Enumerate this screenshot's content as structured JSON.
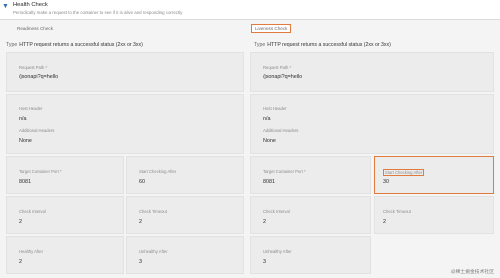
{
  "header": {
    "toggle_glyph": "▼",
    "title": "Health Check",
    "description": "Periodically make a request to the container to see if it is alive and responding correctly"
  },
  "readiness": {
    "label": "Readiness Check",
    "type_key": "Type",
    "type_value": "HTTP request returns a successful status (2xx or 3xx)",
    "request_path_label": "Request Path *",
    "request_path_value": "/jsonapi?q=hello",
    "host_header_label": "Host Header",
    "host_header_value": "n/a",
    "additional_headers_label": "Additional Headers",
    "additional_headers_value": "None",
    "target_port_label": "Target Container Port *",
    "target_port_value": "8081",
    "start_checking_label": "Start Checking After",
    "start_checking_value": "60",
    "check_interval_label": "Check Interval",
    "check_interval_value": "2",
    "check_timeout_label": "Check Timeout",
    "check_timeout_value": "2",
    "healthy_after_label": "Healthy After",
    "healthy_after_value": "2",
    "unhealthy_after_label": "Unhealthy After",
    "unhealthy_after_value": "3"
  },
  "liveness": {
    "label": "Liveness Check",
    "type_key": "Type",
    "type_value": "HTTP request returns a successful status (2xx or 3xx)",
    "request_path_label": "Request Path *",
    "request_path_value": "/jsonapi?q=hello",
    "host_header_label": "Host Header",
    "host_header_value": "n/a",
    "additional_headers_label": "Additional Headers",
    "additional_headers_value": "None",
    "target_port_label": "Target Container Port *",
    "target_port_value": "8081",
    "start_checking_label": "Start Checking After",
    "start_checking_value": "30",
    "check_interval_label": "Check Interval",
    "check_interval_value": "2",
    "check_timeout_label": "Check Timeout",
    "check_timeout_value": "2",
    "unhealthy_after_label": "Unhealthy After",
    "unhealthy_after_value": "3"
  },
  "watermark": "@稀土掘金技术社区",
  "colors": {
    "accent": "#e07b3c",
    "card_bg": "#ececec",
    "page_bg": "#f4f4f4"
  }
}
